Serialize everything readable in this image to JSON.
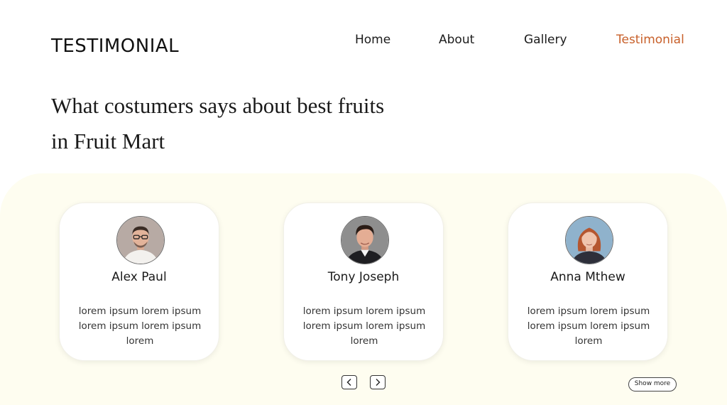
{
  "brand": "TESTIMONIAL",
  "nav": {
    "items": [
      {
        "label": "Home"
      },
      {
        "label": "About"
      },
      {
        "label": "Gallery"
      },
      {
        "label": "Testimonial",
        "active": true
      }
    ],
    "active_color": "#c8602a"
  },
  "headline": "What costumers says about best fruits in Fruit Mart",
  "colors": {
    "band_background": "#fefdf0",
    "card_background": "#ffffff"
  },
  "testimonials": [
    {
      "name": "Alex Paul",
      "text": "lorem ipsum lorem ipsum lorem ipsum lorem ipsum lorem",
      "avatar": "man-glasses-avatar"
    },
    {
      "name": "Tony Joseph",
      "text": "lorem ipsum lorem ipsum lorem ipsum lorem ipsum lorem",
      "avatar": "man-suit-avatar"
    },
    {
      "name": "Anna Mthew",
      "text": "lorem ipsum lorem ipsum lorem ipsum lorem ipsum lorem",
      "avatar": "woman-red-hair-avatar"
    }
  ],
  "controls": {
    "prev_icon": "chevron-left-icon",
    "next_icon": "chevron-right-icon",
    "show_more": "Show more"
  }
}
